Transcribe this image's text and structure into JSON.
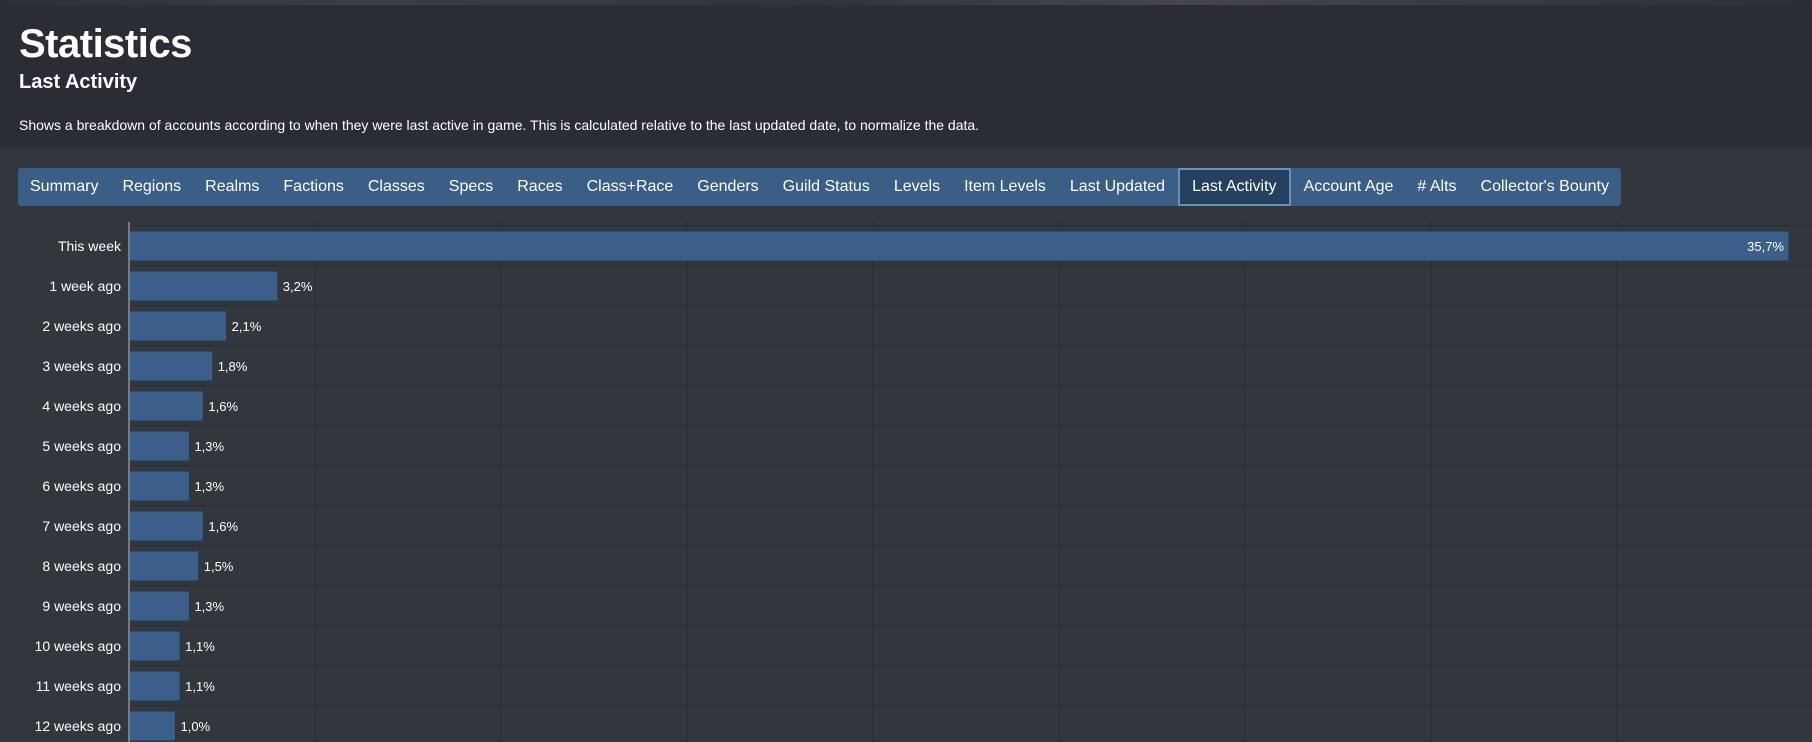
{
  "header": {
    "title": "Statistics",
    "subtitle": "Last Activity",
    "description": "Shows a breakdown of accounts according to when they were last active in game. This is calculated relative to the last updated date, to normalize the data."
  },
  "tabs": [
    {
      "label": "Summary",
      "active": false
    },
    {
      "label": "Regions",
      "active": false
    },
    {
      "label": "Realms",
      "active": false
    },
    {
      "label": "Factions",
      "active": false
    },
    {
      "label": "Classes",
      "active": false
    },
    {
      "label": "Specs",
      "active": false
    },
    {
      "label": "Races",
      "active": false
    },
    {
      "label": "Class+Race",
      "active": false
    },
    {
      "label": "Genders",
      "active": false
    },
    {
      "label": "Guild Status",
      "active": false
    },
    {
      "label": "Levels",
      "active": false
    },
    {
      "label": "Item Levels",
      "active": false
    },
    {
      "label": "Last Updated",
      "active": false
    },
    {
      "label": "Last Activity",
      "active": true
    },
    {
      "label": "Account Age",
      "active": false
    },
    {
      "label": "# Alts",
      "active": false
    },
    {
      "label": "Collector's Bounty",
      "active": false
    }
  ],
  "colors": {
    "bar": "#3b5f88",
    "grid": "#2a2e33",
    "tab_bg": "#3a5e86",
    "tab_active": "#253f5e"
  },
  "chart_data": {
    "type": "bar",
    "orientation": "horizontal",
    "categories": [
      "This week",
      "1 week ago",
      "2 weeks ago",
      "3 weeks ago",
      "4 weeks ago",
      "5 weeks ago",
      "6 weeks ago",
      "7 weeks ago",
      "8 weeks ago",
      "9 weeks ago",
      "10 weeks ago",
      "11 weeks ago",
      "12 weeks ago"
    ],
    "values": [
      35.7,
      3.2,
      2.1,
      1.8,
      1.6,
      1.3,
      1.3,
      1.6,
      1.5,
      1.3,
      1.1,
      1.1,
      1.0
    ],
    "value_labels": [
      "35,7%",
      "3,2%",
      "2,1%",
      "1,8%",
      "1,6%",
      "1,3%",
      "1,3%",
      "1,6%",
      "1,5%",
      "1,3%",
      "1,1%",
      "1,1%",
      "1,0%"
    ],
    "xlim": [
      0,
      35.7
    ],
    "grid": true
  }
}
